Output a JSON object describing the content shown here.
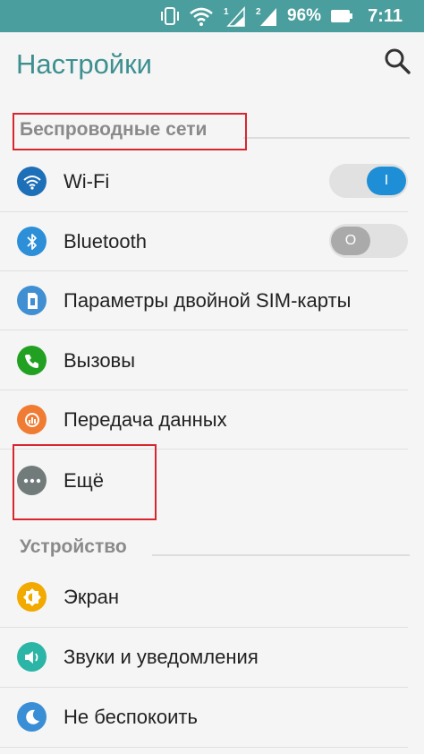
{
  "status_bar": {
    "battery_percent": "96%",
    "time": "7:11",
    "icons": [
      "vibrate-icon",
      "wifi-icon",
      "sim1-signal-icon",
      "sim2-signal-icon",
      "battery-icon"
    ]
  },
  "header": {
    "title": "Настройки",
    "search_icon": "search-icon"
  },
  "sections": [
    {
      "title": "Беспроводные сети",
      "items": [
        {
          "label": "Wi-Fi",
          "icon": "wifi-icon",
          "color": "#1d6fb8",
          "toggle": "on",
          "toggle_text": "I"
        },
        {
          "label": "Bluetooth",
          "icon": "bluetooth-icon",
          "color": "#2c8fd8",
          "toggle": "off",
          "toggle_text": "O"
        },
        {
          "label": "Параметры двойной SIM-карты",
          "icon": "dual-sim-icon",
          "color": "#3f8fd2"
        },
        {
          "label": "Вызовы",
          "icon": "phone-icon",
          "color": "#22a022"
        },
        {
          "label": "Передача данных",
          "icon": "data-usage-icon",
          "color": "#f07b32"
        },
        {
          "label": "Ещё",
          "icon": "more-icon",
          "color": "#707b7a"
        }
      ]
    },
    {
      "title": "Устройство",
      "items": [
        {
          "label": "Экран",
          "icon": "brightness-icon",
          "color": "#f2a900"
        },
        {
          "label": "Звуки и уведомления",
          "icon": "volume-icon",
          "color": "#2bb5a6"
        },
        {
          "label": "Не беспокоить",
          "icon": "moon-icon",
          "color": "#3a8ed6"
        }
      ]
    }
  ],
  "colors": {
    "status_bar": "#4a9e9d",
    "title": "#3d8f90",
    "highlight": "#d9262e",
    "toggle_on": "#1e8fd6"
  }
}
